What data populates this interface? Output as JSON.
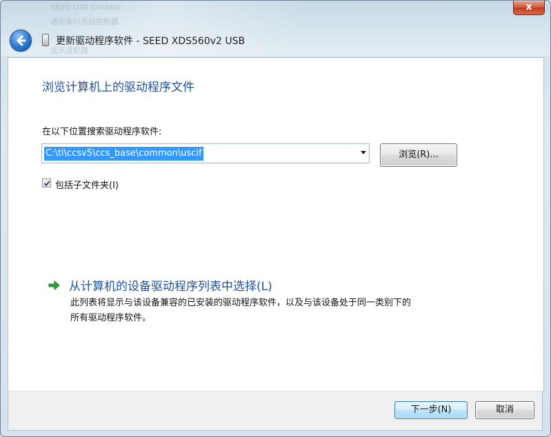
{
  "window": {
    "background_items": [
      "SEED USB Emulator",
      "通用串行总线控制器",
      "显示适配器"
    ],
    "close_label": "x",
    "title": "更新驱动程序软件 - SEED XDS560v2 USB"
  },
  "content": {
    "heading": "浏览计算机上的驱动程序文件",
    "search_label": "在以下位置搜索驱动程序软件:",
    "path_value": "C:\\ti\\ccsv5\\ccs_base\\common\\uscif",
    "browse_label": "浏览(R)...",
    "include_subfolders_label": "包括子文件夹(I)",
    "include_subfolders_checked": true,
    "pick_link": "从计算机的设备驱动程序列表中选择(L)",
    "pick_desc_line1": "此列表将显示与该设备兼容的已安装的驱动程序软件，以及与该设备处于同一类别下的",
    "pick_desc_line2": "所有驱动程序软件。"
  },
  "footer": {
    "next_label": "下一步(N)",
    "cancel_label": "取消"
  },
  "colors": {
    "heading": "#1f4f9a",
    "selection": "#3399ff",
    "link_arrow": "#2fa23a"
  },
  "icons": [
    "back-arrow-icon",
    "usb-device-icon",
    "checkmark-icon",
    "dropdown-arrow-icon",
    "green-arrow-icon",
    "close-icon"
  ]
}
